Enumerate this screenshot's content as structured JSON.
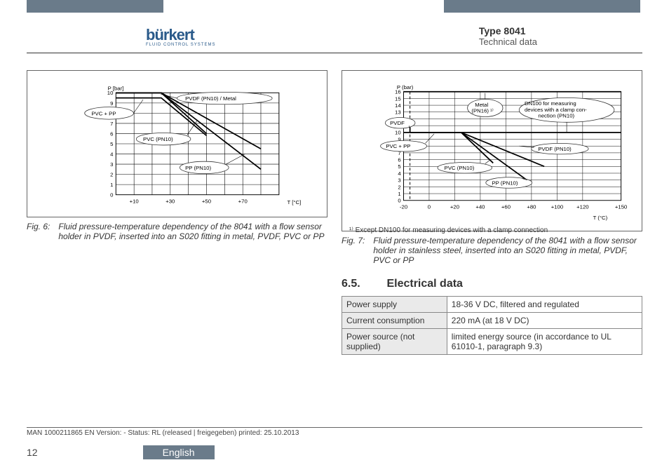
{
  "header": {
    "logo_text": "bürkert",
    "logo_sub": "FLUID CONTROL SYSTEMS",
    "type": "Type 8041",
    "subtitle": "Technical data"
  },
  "fig6": {
    "label": "Fig. 6:",
    "caption": "Fluid pressure-temperature dependency of the 8041 with a flow sensor holder in PVDF, inserted into an S020 fitting in metal, PVDF, PVC or PP",
    "ylabel": "P [bar]",
    "xlabel": "T [°C]",
    "labels": {
      "pvdf_metal": "PVDF (PN10) / Metal",
      "pvc_pp": "PVC + PP",
      "pvc_pn10": "PVC (PN10)",
      "pp_pn10": "PP (PN10)"
    }
  },
  "fig7": {
    "label": "Fig. 7:",
    "caption": "Fluid pressure-temperature dependency of the 8041 with a flow sensor holder in stainless steel, inserted into an S020 fitting in metal, PVDF, PVC or PP",
    "footnote": "¹⁾ Except DN100 for measuring devices with a clamp connection",
    "ylabel": "P (bar)",
    "xlabel": "T (°C)",
    "labels": {
      "metal": "Metal",
      "metal2": "(PN16) ¹⁾",
      "dn100a": "DN100 for measuring",
      "dn100b": "devices with a clamp con-",
      "dn100c": "nection (PN10)",
      "pvdf": "PVDF",
      "pvc_pp": "PVC + PP",
      "pvdf_pn10": "PVDF (PN10)",
      "pvc_pn10": "PVC (PN10)",
      "pp_pn10": "PP (PN10)"
    }
  },
  "chart_data": [
    {
      "type": "line",
      "title": "Fig. 6 pressure-temperature curves",
      "xlabel": "T [°C]",
      "ylabel": "P [bar]",
      "xlim": [
        0,
        90
      ],
      "ylim": [
        0,
        10
      ],
      "x_ticks": [
        "+10",
        "+30",
        "+50",
        "+70"
      ],
      "y_ticks": [
        0,
        1,
        2,
        3,
        4,
        5,
        6,
        7,
        8,
        9,
        10
      ],
      "series": [
        {
          "name": "PVDF (PN10) / Metal",
          "points": [
            [
              0,
              10
            ],
            [
              25,
              10
            ],
            [
              80,
              4.5
            ]
          ]
        },
        {
          "name": "PVC + PP",
          "points": [
            [
              0,
              9.5
            ],
            [
              25,
              9.5
            ],
            [
              50,
              5.8
            ]
          ]
        },
        {
          "name": "PVC (PN10)",
          "points": [
            [
              0,
              10
            ],
            [
              25,
              10
            ],
            [
              50,
              6
            ]
          ]
        },
        {
          "name": "PP (PN10)",
          "points": [
            [
              0,
              10
            ],
            [
              25,
              10
            ],
            [
              80,
              2.5
            ]
          ]
        }
      ]
    },
    {
      "type": "line",
      "title": "Fig. 7 pressure-temperature curves",
      "xlabel": "T (°C)",
      "ylabel": "P (bar)",
      "xlim": [
        -20,
        150
      ],
      "ylim": [
        0,
        16
      ],
      "x_ticks": [
        "-20",
        "0",
        "+20",
        "+40",
        "+60",
        "+80",
        "+100",
        "+120",
        "+150"
      ],
      "y_ticks": [
        0,
        1,
        2,
        3,
        4,
        5,
        6,
        7,
        8,
        9,
        10,
        11,
        12,
        13,
        14,
        15,
        16
      ],
      "series": [
        {
          "name": "Metal (PN16)",
          "points": [
            [
              -20,
              16
            ],
            [
              150,
              16
            ]
          ]
        },
        {
          "name": "DN100 clamp (PN10)",
          "points": [
            [
              -20,
              10
            ],
            [
              150,
              10
            ]
          ]
        },
        {
          "name": "PVDF",
          "points": [
            [
              -15,
              11.5
            ],
            [
              -15,
              10
            ]
          ]
        },
        {
          "name": "PVC + PP",
          "points": [
            [
              0,
              10
            ],
            [
              25,
              10
            ]
          ]
        },
        {
          "name": "PVDF (PN10)",
          "points": [
            [
              -15,
              10
            ],
            [
              25,
              10
            ],
            [
              90,
              5
            ]
          ]
        },
        {
          "name": "PVC (PN10)",
          "points": [
            [
              0,
              10
            ],
            [
              25,
              10
            ],
            [
              50,
              5.5
            ]
          ]
        },
        {
          "name": "PP (PN10)",
          "points": [
            [
              0,
              10
            ],
            [
              25,
              10
            ],
            [
              80,
              2.5
            ]
          ]
        }
      ]
    }
  ],
  "section": {
    "num": "6.5.",
    "title": "Electrical data"
  },
  "electrical": [
    {
      "k": "Power supply",
      "v": "18-36 V DC, filtered and regulated"
    },
    {
      "k": "Current consumption",
      "v": "220 mA (at 18 V DC)"
    },
    {
      "k": "Power source (not supplied)",
      "v": "limited energy source (in accordance to UL 61010-1, paragraph 9.3)"
    }
  ],
  "footer": {
    "docline": "MAN 1000211865 EN Version: - Status: RL (released | freigegeben) printed: 25.10.2013",
    "page": "12",
    "language": "English"
  }
}
